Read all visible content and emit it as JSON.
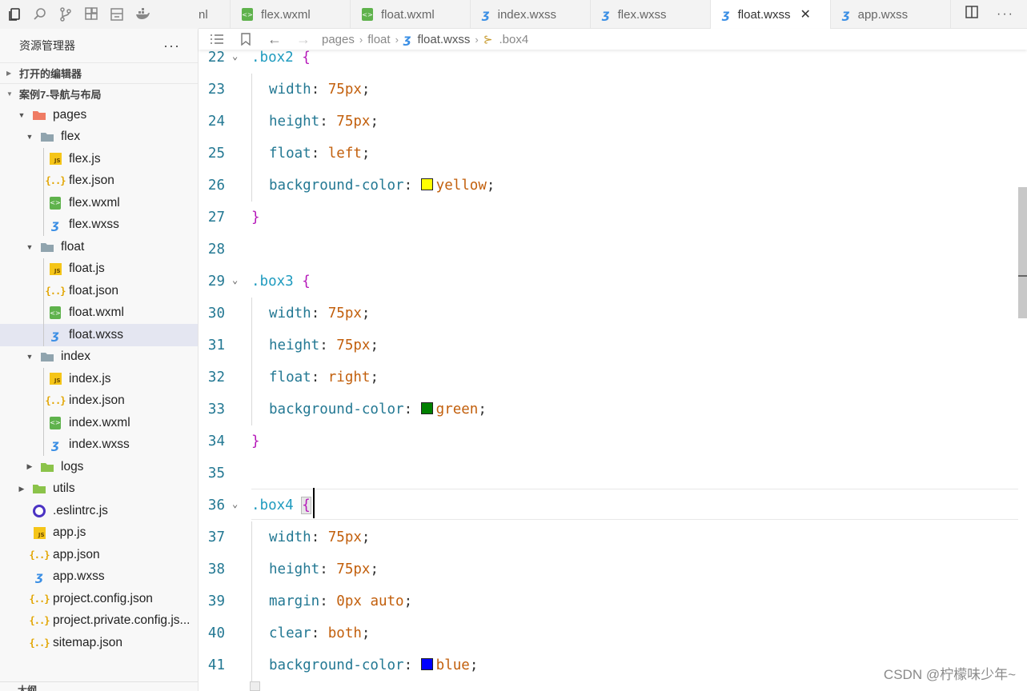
{
  "explorer": {
    "title": "资源管理器",
    "more": "···",
    "open_editors": "打开的编辑器",
    "project": "案例7-导航与布局",
    "outline": "大纲",
    "tree": [
      {
        "label": "pages",
        "type": "folder-special",
        "depth": 0,
        "expanded": true
      },
      {
        "label": "flex",
        "type": "folder",
        "depth": 1,
        "expanded": true
      },
      {
        "label": "flex.js",
        "type": "js",
        "depth": 2
      },
      {
        "label": "flex.json",
        "type": "json",
        "depth": 2
      },
      {
        "label": "flex.wxml",
        "type": "wxml",
        "depth": 2
      },
      {
        "label": "flex.wxss",
        "type": "wxss",
        "depth": 2
      },
      {
        "label": "float",
        "type": "folder",
        "depth": 1,
        "expanded": true
      },
      {
        "label": "float.js",
        "type": "js",
        "depth": 2
      },
      {
        "label": "float.json",
        "type": "json",
        "depth": 2
      },
      {
        "label": "float.wxml",
        "type": "wxml",
        "depth": 2
      },
      {
        "label": "float.wxss",
        "type": "wxss",
        "depth": 2,
        "selected": true
      },
      {
        "label": "index",
        "type": "folder",
        "depth": 1,
        "expanded": true
      },
      {
        "label": "index.js",
        "type": "js",
        "depth": 2
      },
      {
        "label": "index.json",
        "type": "json",
        "depth": 2
      },
      {
        "label": "index.wxml",
        "type": "wxml",
        "depth": 2
      },
      {
        "label": "index.wxss",
        "type": "wxss",
        "depth": 2
      },
      {
        "label": "logs",
        "type": "folder-green",
        "depth": 1,
        "expanded": false
      },
      {
        "label": "utils",
        "type": "folder-green",
        "depth": 0,
        "expanded": false
      },
      {
        "label": ".eslintrc.js",
        "type": "eslint",
        "depth": 0
      },
      {
        "label": "app.js",
        "type": "js",
        "depth": 0
      },
      {
        "label": "app.json",
        "type": "json",
        "depth": 0
      },
      {
        "label": "app.wxss",
        "type": "wxss",
        "depth": 0
      },
      {
        "label": "project.config.json",
        "type": "json",
        "depth": 0
      },
      {
        "label": "project.private.config.js...",
        "type": "json",
        "depth": 0
      },
      {
        "label": "sitemap.json",
        "type": "json",
        "depth": 0
      }
    ]
  },
  "tabs": [
    {
      "label": "nl",
      "type": "none"
    },
    {
      "label": "flex.wxml",
      "type": "wxml"
    },
    {
      "label": "float.wxml",
      "type": "wxml"
    },
    {
      "label": "index.wxss",
      "type": "wxss"
    },
    {
      "label": "flex.wxss",
      "type": "wxss"
    },
    {
      "label": "float.wxss",
      "type": "wxss",
      "active": true
    },
    {
      "label": "app.wxss",
      "type": "wxss"
    }
  ],
  "tab_close": "✕",
  "breadcrumb": [
    "pages",
    "float",
    "float.wxss",
    ".box4"
  ],
  "code_lines": [
    {
      "n": "22",
      "fold": true,
      "parts": [
        [
          "sel",
          ".box2"
        ],
        [
          "pl",
          " "
        ],
        [
          "brace",
          "{"
        ]
      ]
    },
    {
      "n": "23",
      "indent": true,
      "parts": [
        [
          "prop",
          "width"
        ],
        [
          "colon",
          ": "
        ],
        [
          "num",
          "75px"
        ],
        [
          "semi",
          ";"
        ]
      ]
    },
    {
      "n": "24",
      "indent": true,
      "parts": [
        [
          "prop",
          "height"
        ],
        [
          "colon",
          ": "
        ],
        [
          "num",
          "75px"
        ],
        [
          "semi",
          ";"
        ]
      ]
    },
    {
      "n": "25",
      "indent": true,
      "parts": [
        [
          "prop",
          "float"
        ],
        [
          "colon",
          ": "
        ],
        [
          "val",
          "left"
        ],
        [
          "semi",
          ";"
        ]
      ]
    },
    {
      "n": "26",
      "indent": true,
      "parts": [
        [
          "prop",
          "background-color"
        ],
        [
          "colon",
          ": "
        ],
        [
          "swatch",
          "#ffff00"
        ],
        [
          "val",
          "yellow"
        ],
        [
          "semi",
          ";"
        ]
      ]
    },
    {
      "n": "27",
      "parts": [
        [
          "brace",
          "}"
        ]
      ]
    },
    {
      "n": "28",
      "parts": []
    },
    {
      "n": "29",
      "fold": true,
      "parts": [
        [
          "sel",
          ".box3"
        ],
        [
          "pl",
          " "
        ],
        [
          "brace",
          "{"
        ]
      ]
    },
    {
      "n": "30",
      "indent": true,
      "parts": [
        [
          "prop",
          "width"
        ],
        [
          "colon",
          ": "
        ],
        [
          "num",
          "75px"
        ],
        [
          "semi",
          ";"
        ]
      ]
    },
    {
      "n": "31",
      "indent": true,
      "parts": [
        [
          "prop",
          "height"
        ],
        [
          "colon",
          ": "
        ],
        [
          "num",
          "75px"
        ],
        [
          "semi",
          ";"
        ]
      ]
    },
    {
      "n": "32",
      "indent": true,
      "parts": [
        [
          "prop",
          "float"
        ],
        [
          "colon",
          ": "
        ],
        [
          "val",
          "right"
        ],
        [
          "semi",
          ";"
        ]
      ]
    },
    {
      "n": "33",
      "indent": true,
      "parts": [
        [
          "prop",
          "background-color"
        ],
        [
          "colon",
          ": "
        ],
        [
          "swatch",
          "#008000"
        ],
        [
          "val",
          "green"
        ],
        [
          "semi",
          ";"
        ]
      ]
    },
    {
      "n": "34",
      "parts": [
        [
          "brace",
          "}"
        ]
      ]
    },
    {
      "n": "35",
      "parts": []
    },
    {
      "n": "36",
      "fold": true,
      "current": true,
      "parts": [
        [
          "sel",
          ".box4"
        ],
        [
          "pl",
          " "
        ],
        [
          "bracematch",
          "{"
        ]
      ]
    },
    {
      "n": "37",
      "indent": true,
      "parts": [
        [
          "prop",
          "width"
        ],
        [
          "colon",
          ": "
        ],
        [
          "num",
          "75px"
        ],
        [
          "semi",
          ";"
        ]
      ]
    },
    {
      "n": "38",
      "indent": true,
      "parts": [
        [
          "prop",
          "height"
        ],
        [
          "colon",
          ": "
        ],
        [
          "num",
          "75px"
        ],
        [
          "semi",
          ";"
        ]
      ]
    },
    {
      "n": "39",
      "indent": true,
      "parts": [
        [
          "prop",
          "margin"
        ],
        [
          "colon",
          ": "
        ],
        [
          "num",
          "0px"
        ],
        [
          "pl",
          " "
        ],
        [
          "val",
          "auto"
        ],
        [
          "semi",
          ";"
        ]
      ]
    },
    {
      "n": "40",
      "indent": true,
      "parts": [
        [
          "prop",
          "clear"
        ],
        [
          "colon",
          ": "
        ],
        [
          "val",
          "both"
        ],
        [
          "semi",
          ";"
        ]
      ]
    },
    {
      "n": "41",
      "indent": true,
      "parts": [
        [
          "prop",
          "background-color"
        ],
        [
          "colon",
          ": "
        ],
        [
          "swatch",
          "#0000ff"
        ],
        [
          "val",
          "blue"
        ],
        [
          "semi",
          ";"
        ]
      ]
    }
  ],
  "watermark": "CSDN @柠檬味少年~"
}
